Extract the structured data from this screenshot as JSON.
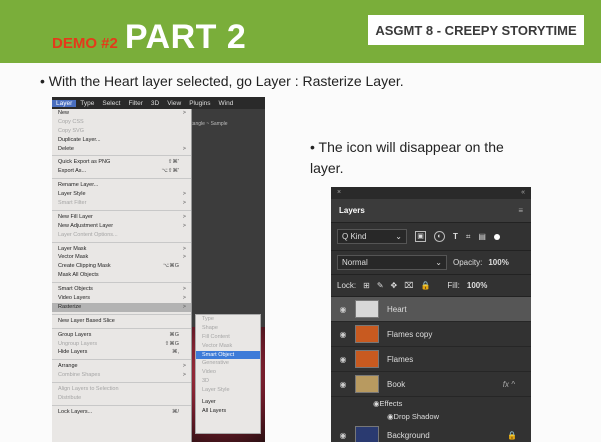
{
  "slide": {
    "demo_label": "DEMO #2",
    "title": "PART 2",
    "badge": "ASGMT 8 - CREEPY STORYTIME",
    "bullet1": "With the Heart layer selected, go Layer : Rasterize Layer.",
    "bullet2": "The icon will disappear on the layer.",
    "bullet_glyph": "•"
  },
  "colors": {
    "title_bar": "#7aae3a",
    "demo_accent": "#e43a1a",
    "menu_highlight": "#3d7bd8"
  },
  "menubar": [
    "Layer",
    "Type",
    "Select",
    "Filter",
    "3D",
    "View",
    "Plugins",
    "Wind"
  ],
  "layer_menu": [
    {
      "label": "New",
      "arrow": ">"
    },
    {
      "label": "Copy CSS",
      "disabled": true
    },
    {
      "label": "Copy SVG",
      "disabled": true
    },
    {
      "label": "Duplicate Layer..."
    },
    {
      "label": "Delete",
      "arrow": ">"
    },
    {
      "sep": true
    },
    {
      "label": "Quick Export as PNG",
      "shortcut": "⇧⌘'"
    },
    {
      "label": "Export As...",
      "shortcut": "⌥⇧⌘'"
    },
    {
      "sep": true
    },
    {
      "label": "Rename Layer..."
    },
    {
      "label": "Layer Style",
      "arrow": ">"
    },
    {
      "label": "Smart Filter",
      "disabled": true,
      "arrow": ">"
    },
    {
      "sep": true
    },
    {
      "label": "New Fill Layer",
      "arrow": ">"
    },
    {
      "label": "New Adjustment Layer",
      "arrow": ">"
    },
    {
      "label": "Layer Content Options...",
      "disabled": true
    },
    {
      "sep": true
    },
    {
      "label": "Layer Mask",
      "arrow": ">"
    },
    {
      "label": "Vector Mask",
      "arrow": ">"
    },
    {
      "label": "Create Clipping Mask",
      "shortcut": "⌥⌘G"
    },
    {
      "label": "Mask All Objects"
    },
    {
      "sep": true
    },
    {
      "label": "Smart Objects",
      "arrow": ">"
    },
    {
      "label": "Video Layers",
      "arrow": ">"
    },
    {
      "label": "Rasterize",
      "arrow": ">",
      "highlight": true
    },
    {
      "sep": true
    },
    {
      "label": "New Layer Based Slice"
    },
    {
      "sep": true
    },
    {
      "label": "Group Layers",
      "shortcut": "⌘G"
    },
    {
      "label": "Ungroup Layers",
      "disabled": true,
      "shortcut": "⇧⌘G"
    },
    {
      "label": "Hide Layers",
      "shortcut": "⌘,"
    },
    {
      "sep": true
    },
    {
      "label": "Arrange",
      "arrow": ">"
    },
    {
      "label": "Combine Shapes",
      "disabled": true,
      "arrow": ">"
    },
    {
      "sep": true
    },
    {
      "label": "Align Layers to Selection",
      "disabled": true
    },
    {
      "label": "Distribute",
      "disabled": true
    },
    {
      "sep": true
    },
    {
      "label": "Lock Layers...",
      "shortcut": "⌘/"
    }
  ],
  "rasterize_submenu": [
    {
      "label": "Type"
    },
    {
      "label": "Shape"
    },
    {
      "label": "Fill Content"
    },
    {
      "label": "Vector Mask"
    },
    {
      "label": "Smart Object",
      "highlight": true
    },
    {
      "label": "Generative"
    },
    {
      "label": "Video"
    },
    {
      "label": "3D"
    },
    {
      "label": "Layer Style"
    },
    {
      "sep": true
    },
    {
      "label": "Layer",
      "enabled": true
    },
    {
      "label": "All Layers",
      "enabled": true
    }
  ],
  "behind_rows": [
    "ectangle ~  Sample"
  ],
  "layers_panel": {
    "top_left": "×",
    "top_right": "«",
    "title": "Layers",
    "menu_glyph": "≡",
    "filter_label": "Q Kind",
    "blend_mode": "Normal",
    "opacity_label": "Opacity:",
    "opacity_value": "100%",
    "lock_label": "Lock:",
    "fill_label": "Fill:",
    "fill_value": "100%",
    "layers": [
      {
        "name": "Heart",
        "active": true,
        "thumb": "#d8d8d8"
      },
      {
        "name": "Flames copy",
        "thumb": "#c85a20"
      },
      {
        "name": "Flames",
        "thumb": "#c85a20"
      },
      {
        "name": "Book",
        "thumb": "#b89a60",
        "fx": "fx ^"
      },
      {
        "name": "Background",
        "thumb": "#2a3a70",
        "lock": "🔒"
      }
    ],
    "effects_label": "Effects",
    "drop_shadow_label": "Drop Shadow"
  }
}
